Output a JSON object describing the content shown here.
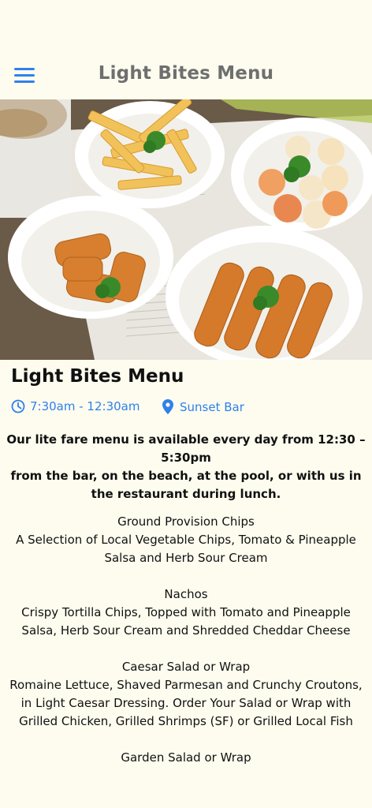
{
  "header": {
    "title": "Light Bites Menu",
    "menu_icon": "hamburger-menu-icon"
  },
  "hero_image": {
    "description": "Plates of french fries, fried fish balls, nuggets and fish fingers"
  },
  "page": {
    "title": "Light Bites Menu",
    "hours": "7:30am - 12:30am",
    "hours_icon": "clock-icon",
    "location": "Sunset Bar",
    "location_icon": "map-pin-icon",
    "intro_line1": "Our lite fare menu is available every day from 12:30 – 5:30pm",
    "intro_line2": "from the bar, on the beach, at the pool, or with us in the restaurant during lunch."
  },
  "menu_items": [
    {
      "name": "Ground Provision Chips",
      "description": "A Selection of Local Vegetable Chips, Tomato & Pineapple Salsa and Herb Sour Cream"
    },
    {
      "name": "Nachos",
      "description": "Crispy Tortilla Chips, Topped with Tomato and Pineapple Salsa, Herb Sour Cream and Shredded Cheddar Cheese"
    },
    {
      "name": "Caesar Salad or Wrap",
      "description": "Romaine Lettuce, Shaved Parmesan and Crunchy Croutons, in Light Caesar Dressing. Order Your Salad or Wrap with Grilled Chicken, Grilled Shrimps (SF) or Grilled Local Fish"
    },
    {
      "name": "Garden Salad or Wrap",
      "description": ""
    }
  ],
  "colors": {
    "background": "#fdfcef",
    "accent": "#2f80ed",
    "header_title": "#6f6f6f",
    "text": "#111111"
  }
}
